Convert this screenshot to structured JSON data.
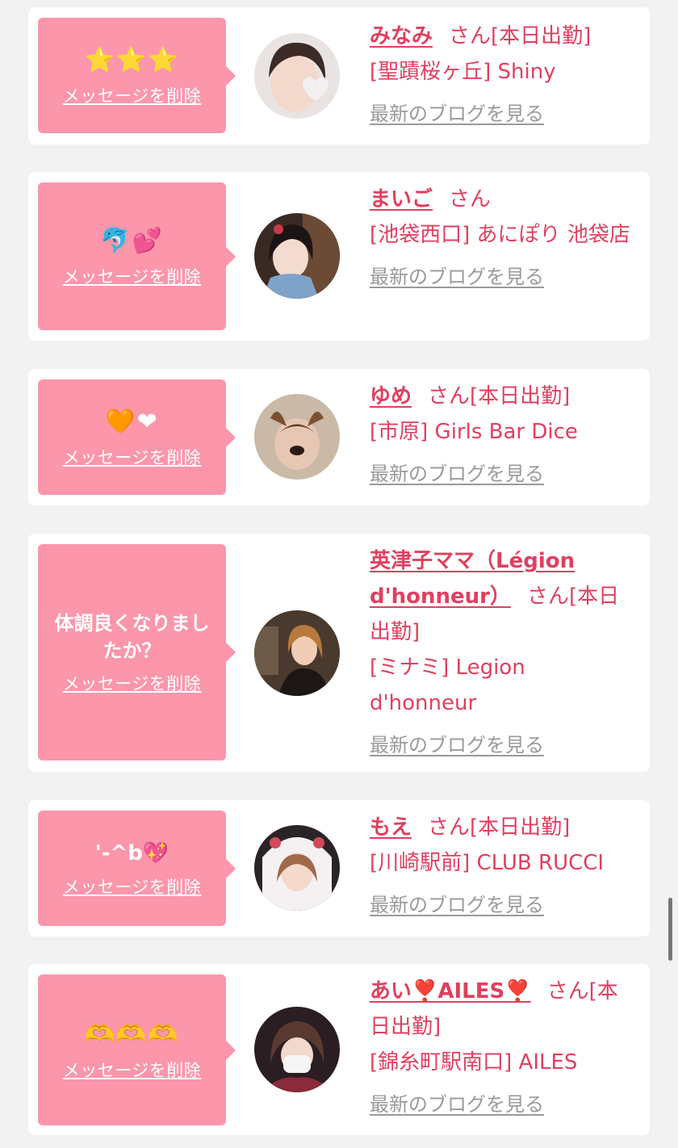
{
  "common": {
    "delete_label": "メッセージを削除",
    "blog_label": "最新のブログを見る",
    "san": "さん"
  },
  "cards": [
    {
      "message": "⭐⭐⭐",
      "name": "みなみ",
      "status": "[本日出勤]",
      "shop": "[聖蹟桜ヶ丘] Shiny"
    },
    {
      "message": "🐬💕",
      "name": "まいご",
      "status": "",
      "shop": "[池袋西口] あにぽり 池袋店"
    },
    {
      "message": "🧡❤",
      "name": "ゆめ",
      "status": "[本日出勤]",
      "shop": "[市原] Girls Bar Dice"
    },
    {
      "message": "体調良くなりましたか？",
      "name": "英津子ママ（Légion d'honneur）",
      "status": "[本日出勤]",
      "shop": "[ミナミ] Legion d'honneur"
    },
    {
      "message": "'-^b💖",
      "name": "もえ",
      "status": "[本日出勤]",
      "shop": "[川崎駅前] CLUB RUCCI"
    },
    {
      "message": "🫶🫶🫶",
      "name": "あい❣️AILES❣️",
      "status": "[本日出勤]",
      "shop": "[錦糸町駅南口] AILES"
    }
  ],
  "colors": {
    "accent": "#e0405f",
    "bubble": "#fb96ab",
    "background": "#f2f2f2"
  }
}
